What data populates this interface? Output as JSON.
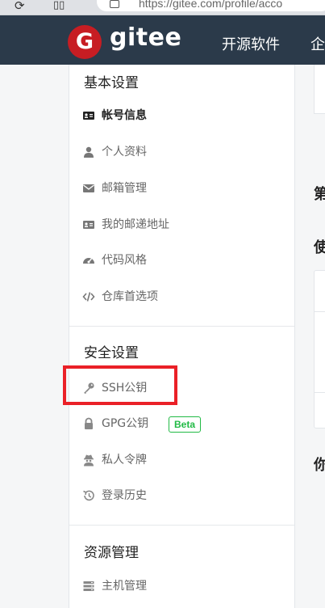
{
  "browser": {
    "url": "https://gitee.com/profile/acco"
  },
  "header": {
    "logo_letter": "G",
    "logo_text": "gitee",
    "nav": [
      "开源软件",
      "企"
    ]
  },
  "sidebar": {
    "sections": [
      {
        "title": "基本设置",
        "items": [
          {
            "label": "帐号信息",
            "icon": "id-card-icon",
            "active": true
          },
          {
            "label": "个人资料",
            "icon": "user-icon"
          },
          {
            "label": "邮箱管理",
            "icon": "mail-icon"
          },
          {
            "label": "我的邮递地址",
            "icon": "address-card-icon"
          },
          {
            "label": "代码风格",
            "icon": "palette-icon"
          },
          {
            "label": "仓库首选项",
            "icon": "code-icon"
          }
        ]
      },
      {
        "title": "安全设置",
        "items": [
          {
            "label": "SSH公钥",
            "icon": "key-icon"
          },
          {
            "label": "GPG公钥",
            "icon": "lock-icon",
            "badge": "Beta"
          },
          {
            "label": "私人令牌",
            "icon": "user-secret-icon"
          },
          {
            "label": "登录历史",
            "icon": "history-icon"
          }
        ]
      },
      {
        "title": "资源管理",
        "items": [
          {
            "label": "主机管理",
            "icon": "server-icon"
          }
        ]
      }
    ]
  },
  "right": {
    "chars": [
      "第",
      "使",
      "你"
    ]
  },
  "colors": {
    "header_bg": "#2b3a4a",
    "brand_red": "#c71d23",
    "highlight": "#ea2027",
    "badge_green": "#21ba45"
  }
}
